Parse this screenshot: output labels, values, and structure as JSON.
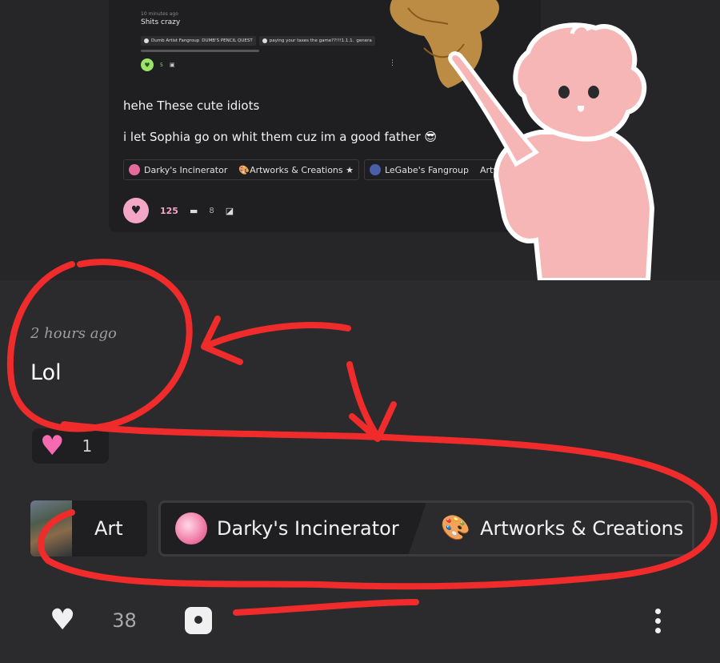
{
  "embedded_post": {
    "mini": {
      "meta": "10 minutes ago",
      "text": "Shits crazy",
      "tags": [
        "Dumb Artist Fangroup",
        "DUMB'S PENCIL QUEST",
        "paying your taxes the game??!!!1.1.1.",
        "genera"
      ],
      "like_count": "5"
    },
    "line1": "hehe These cute idiots",
    "line2": "i let Sophia go on whit them cuz im a good father 😎",
    "tags": [
      {
        "name": "Darky's Incinerator",
        "extra": "🎨Artworks & Creations ★"
      },
      {
        "name": "LeGabe's Fangroup",
        "extra": "Artwo"
      }
    ],
    "like_count": "125",
    "comment_count": "8"
  },
  "post": {
    "timestamp": "2 hours ago",
    "text": "Lol",
    "reaction_count": "1",
    "folder": "Art",
    "tags": [
      {
        "name": "Darky's Incinerator",
        "icon": "avatar"
      },
      {
        "name": "Artworks & Creations",
        "icon": "palette-icon"
      }
    ],
    "like_count": "38"
  },
  "colors": {
    "background": "#2b2b2d",
    "surface": "#1f1f21",
    "accent_pink": "#f56ab0",
    "annotation_red": "#ef2b2b",
    "mini_like_green": "#9be36b"
  }
}
